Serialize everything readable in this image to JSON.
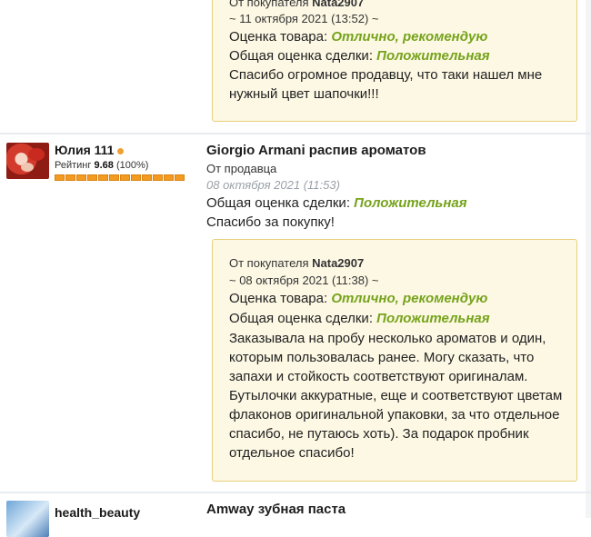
{
  "top_quote": {
    "from_prefix": "От покупателя",
    "from_user": "Nata2907",
    "date": "~ 11 октября 2021 (13:52) ~",
    "product_rating_label": "Оценка товара:",
    "product_rating_value": "Отлично, рекомендую",
    "deal_rating_label": "Общая оценка сделки:",
    "deal_rating_value": "Положительная",
    "text_lines": [
      "Спасибо огромное продавцу, что таки нашел мне",
      "нужный цвет шапочки!!!"
    ]
  },
  "review1": {
    "user": {
      "name": "Юлия 111",
      "rating_prefix": "Рейтинг",
      "rating_value": "9.68",
      "rating_percent": "(100%)",
      "avatar_icon": "avatar-photo"
    },
    "title": "Giorgio Armani распив ароматов",
    "from": "От продавца",
    "date": "08 октября 2021 (11:53)",
    "deal_rating_label": "Общая оценка сделки:",
    "deal_rating_value": "Положительная",
    "text": "Спасибо за покупку!",
    "quote": {
      "from_prefix": "От покупателя",
      "from_user": "Nata2907",
      "date": "~ 08 октября 2021 (11:38) ~",
      "product_rating_label": "Оценка товара:",
      "product_rating_value": "Отлично, рекомендую",
      "deal_rating_label": "Общая оценка сделки:",
      "deal_rating_value": "Положительная",
      "text_lines": [
        "Заказывала на пробу несколько ароматов и один,",
        "которым пользовалась ранее. Могу сказать, что",
        "запахи и стойкость соответствуют оригиналам.",
        "Бутылочки аккуратные, еще и соответствуют цветам",
        "флаконов оригинальной упаковки, за что отдельное",
        "спасибо, не путаюсь хоть). За подарок пробник",
        "отдельное спасибо!"
      ]
    }
  },
  "review2": {
    "user": {
      "name": "health_beauty",
      "avatar_icon": "avatar-photo"
    },
    "title": "Amway зубная паста"
  },
  "colors": {
    "accent_green": "#76a31c",
    "quote_bg": "#fdf8e4",
    "quote_border": "#e9cf7a",
    "rating_bar": "#f39a21",
    "online_dot": "#f0a030"
  }
}
